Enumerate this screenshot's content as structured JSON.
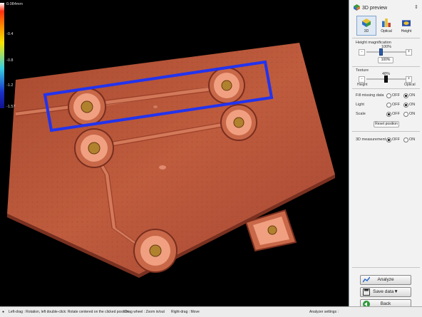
{
  "viewport": {
    "colorbar": {
      "ticks": [
        "0.084mm",
        "-0.4",
        "-0.8",
        "-1.2",
        "-1.57"
      ]
    }
  },
  "panel": {
    "title": "3D preview",
    "tabs": [
      {
        "label": "3D",
        "icon": "3d-view-icon"
      },
      {
        "label": "Optical",
        "icon": "optical-icon"
      },
      {
        "label": "Height",
        "icon": "height-icon"
      }
    ],
    "height_magnification": {
      "label": "Height magnification",
      "value": "100%",
      "button": "100%",
      "level_fraction": 0.35
    },
    "texture": {
      "label": "Texture",
      "value": "48%",
      "left": "Height",
      "right": "Optical",
      "level_fraction": 0.48
    },
    "fill_missing": {
      "label": "Fill missing data",
      "off": "OFF",
      "on": "ON",
      "selected": "ON"
    },
    "light": {
      "label": "Light",
      "off": "OFF",
      "on": "ON",
      "selected": "ON"
    },
    "scale": {
      "label": "Scale",
      "off": "OFF",
      "on": "ON",
      "selected": "OFF"
    },
    "reset_position": "Reset position",
    "measurement": {
      "label": "3D measurement",
      "off": "OFF",
      "on": "ON",
      "selected": "OFF"
    },
    "analyze": "Analyze",
    "save_data": "Save data▼",
    "back": "Back"
  },
  "statusbar": {
    "left_drag": "Left-drag : Rotation, left double-click: Rotate centered on the clicked position",
    "wheel": "Drag wheel : Zoom in/out",
    "right_drag": "Right-drag : Move",
    "analyzer": "Analyzer settings :"
  },
  "colors": {
    "board": "#b85a3e",
    "highlight_box": "#2233ee",
    "pad": "#f0a080",
    "accent": "#2b5ea8"
  }
}
